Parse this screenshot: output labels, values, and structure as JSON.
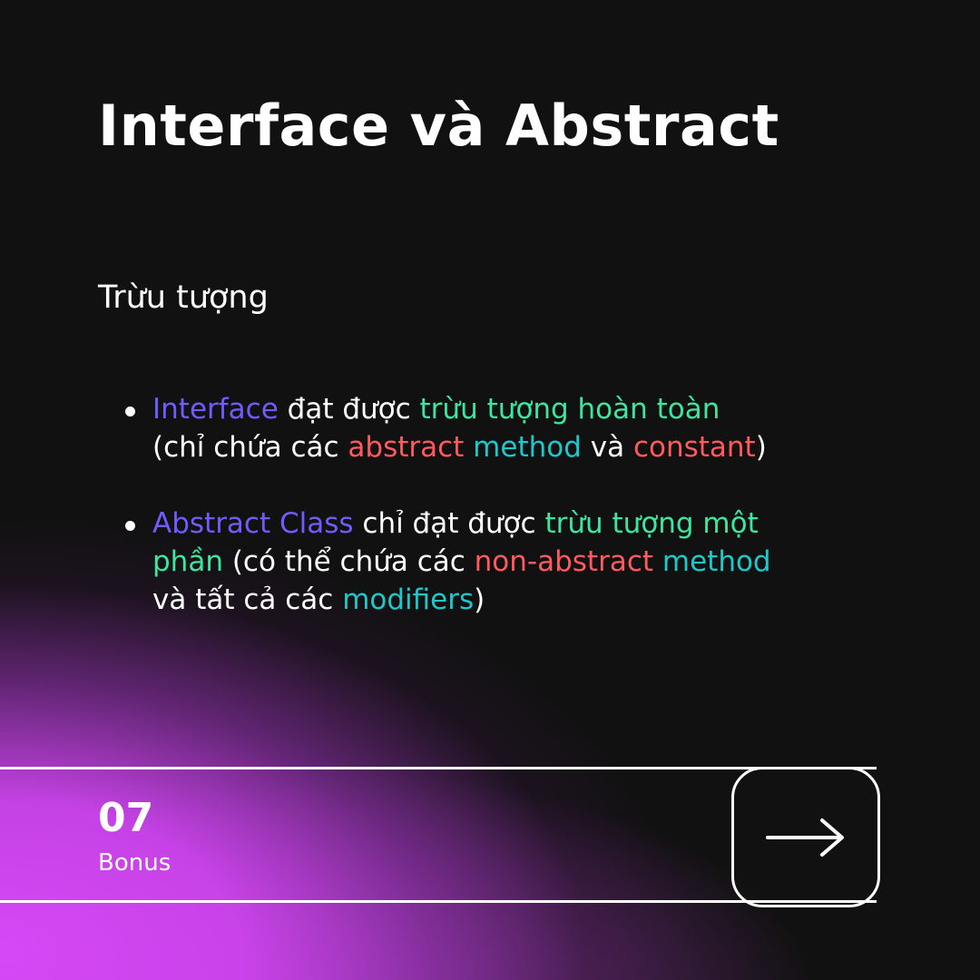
{
  "title": "Interface và Abstract",
  "subtitle": "Trừu tượng",
  "bullets": [
    {
      "segments": [
        {
          "text": "Interface",
          "color": "purple"
        },
        {
          "text": " đạt được ",
          "color": "white"
        },
        {
          "text": "trừu tượng hoàn toàn",
          "color": "green"
        },
        {
          "text": "\n(chỉ chứa các ",
          "color": "white"
        },
        {
          "text": "abstract",
          "color": "red"
        },
        {
          "text": " ",
          "color": "white"
        },
        {
          "text": "method",
          "color": "teal"
        },
        {
          "text": " và ",
          "color": "white"
        },
        {
          "text": "constant",
          "color": "red"
        },
        {
          "text": ")",
          "color": "white"
        }
      ]
    },
    {
      "segments": [
        {
          "text": "Abstract Class",
          "color": "purple"
        },
        {
          "text": " chỉ đạt được ",
          "color": "white"
        },
        {
          "text": "trừu tượng một\nphần",
          "color": "green"
        },
        {
          "text": " (có thể chứa các ",
          "color": "white"
        },
        {
          "text": "non-abstract",
          "color": "red"
        },
        {
          "text": " ",
          "color": "white"
        },
        {
          "text": "method",
          "color": "teal"
        },
        {
          "text": "\nvà tất cả các ",
          "color": "white"
        },
        {
          "text": "modifiers",
          "color": "teal"
        },
        {
          "text": ")",
          "color": "white"
        }
      ]
    }
  ],
  "footer": {
    "page_number": "07",
    "page_label": "Bonus",
    "next_icon": "arrow-right-icon"
  },
  "colors": {
    "background": "#111111",
    "gradient": "#d648f6",
    "purple": "#6f5cff",
    "green": "#3ee59f",
    "red": "#ff5a5f",
    "teal": "#1ec8c8",
    "white": "#ffffff"
  }
}
